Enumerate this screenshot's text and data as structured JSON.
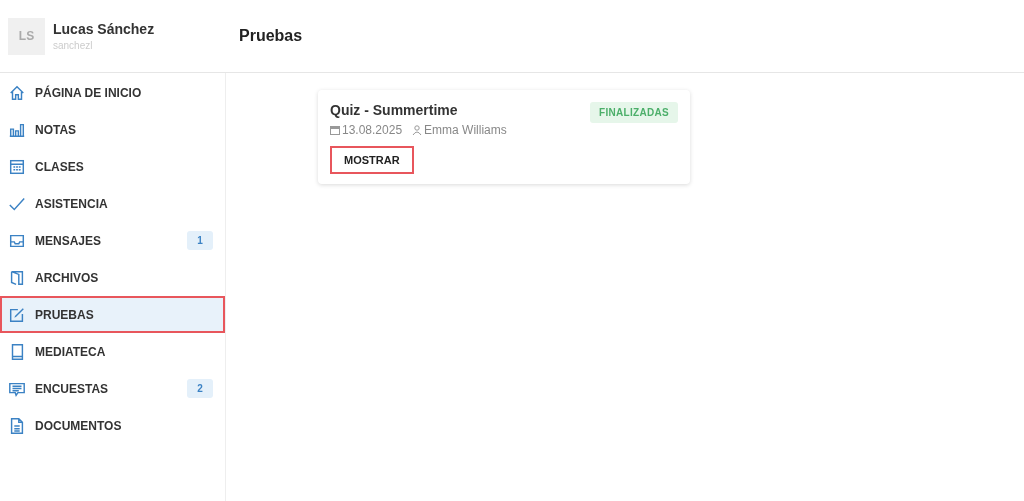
{
  "user": {
    "initials": "LS",
    "name": "Lucas Sánchez",
    "username": "sanchezl"
  },
  "page_title": "Pruebas",
  "sidebar": {
    "items": [
      {
        "label": "PÁGINA DE INICIO",
        "selected": false,
        "highlighted": false
      },
      {
        "label": "NOTAS",
        "selected": false,
        "highlighted": false
      },
      {
        "label": "CLASES",
        "selected": false,
        "highlighted": false
      },
      {
        "label": "ASISTENCIA",
        "selected": false,
        "highlighted": false
      },
      {
        "label": "MENSAJES",
        "selected": false,
        "highlighted": false,
        "badge": "1"
      },
      {
        "label": "ARCHIVOS",
        "selected": false,
        "highlighted": false
      },
      {
        "label": "PRUEBAS",
        "selected": true,
        "highlighted": true
      },
      {
        "label": "MEDIATECA",
        "selected": false,
        "highlighted": false
      },
      {
        "label": "ENCUESTAS",
        "selected": false,
        "highlighted": false,
        "badge": "2"
      },
      {
        "label": "DOCUMENTOS",
        "selected": false,
        "highlighted": false
      }
    ]
  },
  "tests": [
    {
      "title": "Quiz - Summertime",
      "status": "FINALIZADAS",
      "date": "13.08.2025",
      "teacher": "Emma Williams",
      "button": {
        "label": "MOSTRAR",
        "highlighted": true
      }
    }
  ]
}
